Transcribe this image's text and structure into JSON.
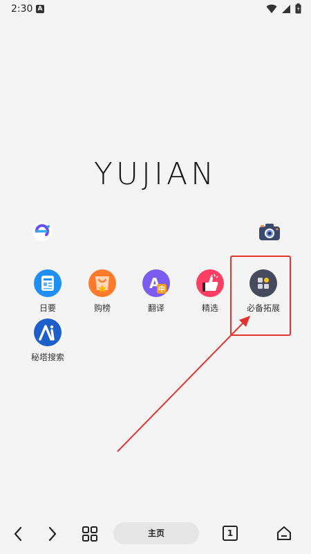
{
  "status": {
    "time": "2:30",
    "badge": "A"
  },
  "logo": {
    "text": "YUJIAN"
  },
  "shortcuts": [
    {
      "label": "日要",
      "icon": "news-icon",
      "color": "#1f8ff3"
    },
    {
      "label": "购榜",
      "icon": "shopping-bag-icon",
      "color": "#ff7b2b"
    },
    {
      "label": "翻译",
      "icon": "translate-icon",
      "color": "#7a5cf0"
    },
    {
      "label": "精选",
      "icon": "thumbs-up-icon",
      "color": "#ff3e63"
    },
    {
      "label": "必备拓展",
      "icon": "extensions-icon",
      "color": "#474a5c"
    },
    {
      "label": "秘塔搜索",
      "icon": "metaso-search-icon",
      "color": "#1d5fc8"
    }
  ],
  "bottom_nav": {
    "home_label": "主页",
    "tab_count": "1"
  }
}
